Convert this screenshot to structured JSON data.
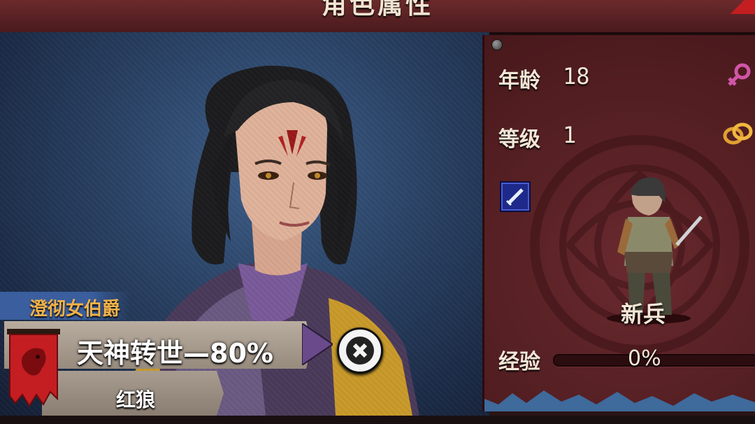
{
  "header": {
    "title": "角色属性"
  },
  "stats": {
    "age_label": "年龄",
    "age_value": "18",
    "level_label": "等级",
    "level_value": "1",
    "exp_label": "经验",
    "exp_value": "0%",
    "exp_progress": 0
  },
  "unit": {
    "name": "新兵"
  },
  "character": {
    "title": "澄彻女伯爵",
    "trait": "天神转世—80%",
    "faction": "红狼"
  },
  "icons": {
    "gender": "female-icon",
    "marriage": "rings-icon",
    "weapon": "dagger-icon",
    "banner": "red-wolf-banner-icon",
    "close": "close-icon"
  },
  "colors": {
    "panel": "#5a2226",
    "title_gold": "#f2b24a",
    "portrait_bg": "#2c466a",
    "banner_red": "#c41e22"
  }
}
